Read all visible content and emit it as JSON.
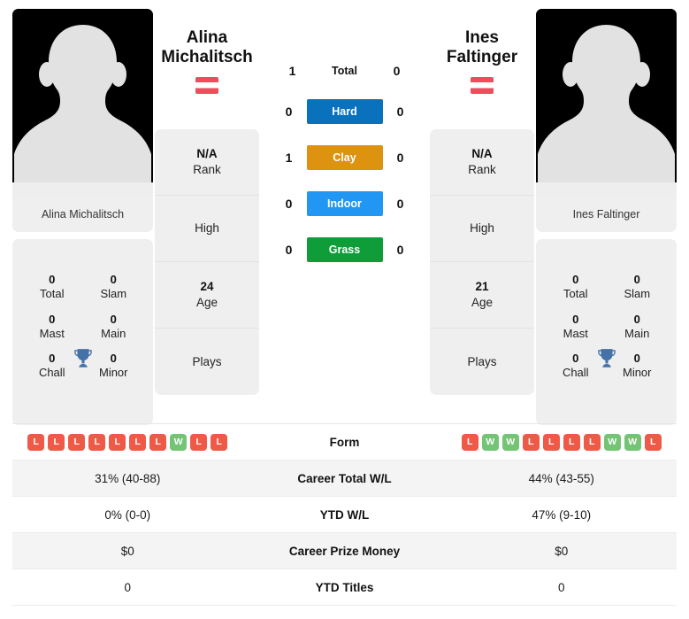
{
  "colors": {
    "hard": "#0a72bd",
    "clay": "#dd9210",
    "indoor": "#2196f3",
    "grass": "#0f9d3a",
    "win": "#74c476",
    "loss": "#ee5a47",
    "card_bg": "#efefef",
    "trophy": "#4472a8",
    "flag_red": "#ef4c5c",
    "flag_white": "#ffffff"
  },
  "players": {
    "left": {
      "first_name": "Alina",
      "last_name": "Michalitsch",
      "full_name": "Alina Michalitsch",
      "country": "Austria",
      "photo_caption": "Alina Michalitsch",
      "info": {
        "rank_value": "N/A",
        "rank_label": "Rank",
        "high_value": "",
        "high_label": "High",
        "age_value": "24",
        "age_label": "Age",
        "plays_value": "",
        "plays_label": "Plays"
      },
      "titles": [
        {
          "value": "0",
          "label": "Total"
        },
        {
          "value": "0",
          "label": "Slam"
        },
        {
          "value": "0",
          "label": "Mast"
        },
        {
          "value": "0",
          "label": "Main"
        },
        {
          "value": "0",
          "label": "Chall"
        },
        {
          "value": "0",
          "label": "Minor"
        }
      ],
      "form": [
        "L",
        "L",
        "L",
        "L",
        "L",
        "L",
        "L",
        "W",
        "L",
        "L"
      ],
      "career_total_wl": "31% (40-88)",
      "ytd_wl": "0% (0-0)",
      "career_prize_money": "$0",
      "ytd_titles": "0"
    },
    "right": {
      "first_name": "Ines",
      "last_name": "Faltinger",
      "full_name": "Ines Faltinger",
      "country": "Austria",
      "photo_caption": "Ines Faltinger",
      "info": {
        "rank_value": "N/A",
        "rank_label": "Rank",
        "high_value": "",
        "high_label": "High",
        "age_value": "21",
        "age_label": "Age",
        "plays_value": "",
        "plays_label": "Plays"
      },
      "titles": [
        {
          "value": "0",
          "label": "Total"
        },
        {
          "value": "0",
          "label": "Slam"
        },
        {
          "value": "0",
          "label": "Mast"
        },
        {
          "value": "0",
          "label": "Main"
        },
        {
          "value": "0",
          "label": "Chall"
        },
        {
          "value": "0",
          "label": "Minor"
        }
      ],
      "form": [
        "L",
        "W",
        "W",
        "L",
        "L",
        "L",
        "L",
        "W",
        "W",
        "L"
      ],
      "career_total_wl": "44% (43-55)",
      "ytd_wl": "47% (9-10)",
      "career_prize_money": "$0",
      "ytd_titles": "0"
    }
  },
  "head_to_head": [
    {
      "label": "Total",
      "left": "1",
      "right": "0",
      "style": "plain",
      "color": ""
    },
    {
      "label": "Hard",
      "left": "0",
      "right": "0",
      "style": "badge",
      "color": "#0a72bd"
    },
    {
      "label": "Clay",
      "left": "1",
      "right": "0",
      "style": "badge",
      "color": "#dd9210"
    },
    {
      "label": "Indoor",
      "left": "0",
      "right": "0",
      "style": "badge",
      "color": "#2196f3"
    },
    {
      "label": "Grass",
      "left": "0",
      "right": "0",
      "style": "badge",
      "color": "#0f9d3a"
    }
  ],
  "comparison_rows": [
    {
      "label": "Form",
      "left": "",
      "right": "",
      "type": "form"
    },
    {
      "label": "Career Total W/L",
      "left": "31% (40-88)",
      "right": "44% (43-55)",
      "type": "text"
    },
    {
      "label": "YTD W/L",
      "left": "0% (0-0)",
      "right": "47% (9-10)",
      "type": "text"
    },
    {
      "label": "Career Prize Money",
      "left": "$0",
      "right": "$0",
      "type": "text"
    },
    {
      "label": "YTD Titles",
      "left": "0",
      "right": "0",
      "type": "text"
    }
  ]
}
